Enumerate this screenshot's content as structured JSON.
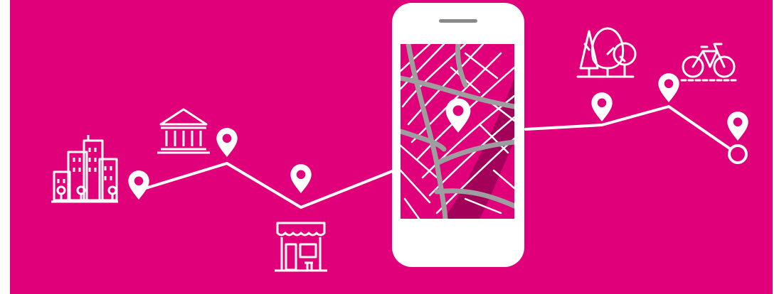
{
  "banner": {
    "background_color": "#E0007A",
    "line_color": "#FFFFFF",
    "map_bg_color": "#E0007A",
    "map_street_color": "#9E9E9E",
    "map_river_color": "#A3005A"
  },
  "icons": {
    "city": "city-buildings-icon",
    "museum": "museum-icon",
    "shop": "shop-awning-icon",
    "phone": "smartphone-icon",
    "map": "city-map-icon",
    "trees": "trees-icon",
    "bike": "bicycle-icon",
    "pin": "location-pin-icon",
    "end": "route-end-circle-icon"
  }
}
